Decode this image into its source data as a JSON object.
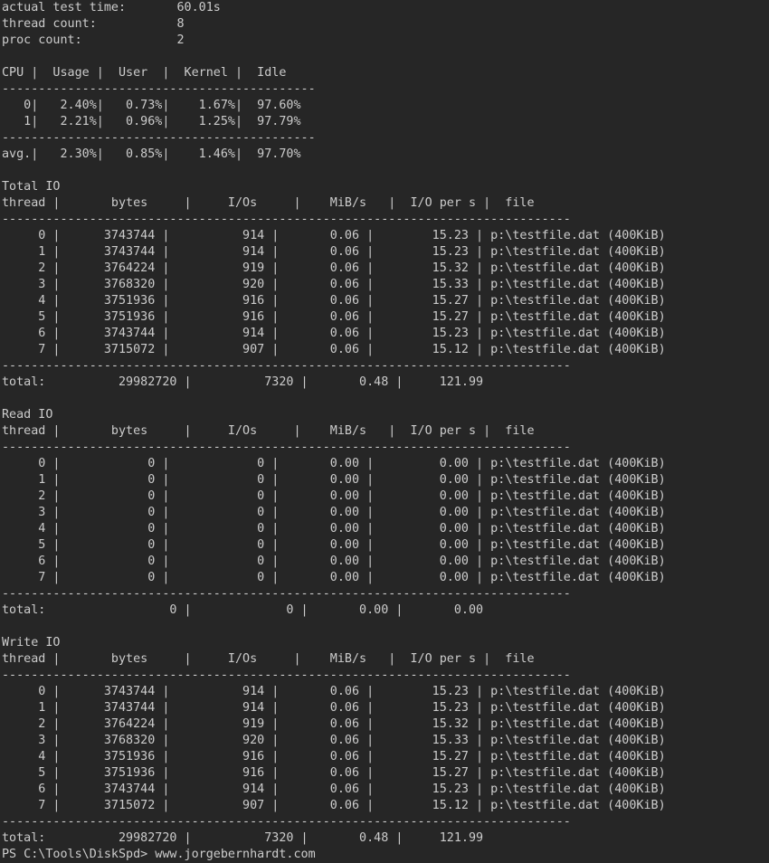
{
  "colors": {
    "background": "#262626",
    "foreground": "#cccccc"
  },
  "summary": [
    {
      "label": "actual test time:",
      "value": "60.01s"
    },
    {
      "label": "thread count:",
      "value": "8"
    },
    {
      "label": "proc count:",
      "value": "2"
    }
  ],
  "cpu_table": {
    "header": "CPU |  Usage |  User  |  Kernel |  Idle",
    "columns": [
      "CPU",
      "Usage",
      "User",
      "Kernel",
      "Idle"
    ],
    "rows": [
      {
        "cpu": "0",
        "usage": "2.40%",
        "user": "0.73%",
        "kernel": "1.67%",
        "idle": "97.60%"
      },
      {
        "cpu": "1",
        "usage": "2.21%",
        "user": "0.96%",
        "kernel": "1.25%",
        "idle": "97.79%"
      }
    ],
    "avg": {
      "cpu": "avg.",
      "usage": "2.30%",
      "user": "0.85%",
      "kernel": "1.46%",
      "idle": "97.70%"
    }
  },
  "io_header": "thread |       bytes     |     I/Os     |    MiB/s   |  I/O per s |  file",
  "io_columns": [
    "thread",
    "bytes",
    "I/Os",
    "MiB/s",
    "I/O per s",
    "file"
  ],
  "io_sections": [
    {
      "title": "Total IO",
      "rows": [
        {
          "thread": "0",
          "bytes": "3743744",
          "ios": "914",
          "mib_s": "0.06",
          "io_per_s": "15.23",
          "file": "p:\\testfile.dat (400KiB)"
        },
        {
          "thread": "1",
          "bytes": "3743744",
          "ios": "914",
          "mib_s": "0.06",
          "io_per_s": "15.23",
          "file": "p:\\testfile.dat (400KiB)"
        },
        {
          "thread": "2",
          "bytes": "3764224",
          "ios": "919",
          "mib_s": "0.06",
          "io_per_s": "15.32",
          "file": "p:\\testfile.dat (400KiB)"
        },
        {
          "thread": "3",
          "bytes": "3768320",
          "ios": "920",
          "mib_s": "0.06",
          "io_per_s": "15.33",
          "file": "p:\\testfile.dat (400KiB)"
        },
        {
          "thread": "4",
          "bytes": "3751936",
          "ios": "916",
          "mib_s": "0.06",
          "io_per_s": "15.27",
          "file": "p:\\testfile.dat (400KiB)"
        },
        {
          "thread": "5",
          "bytes": "3751936",
          "ios": "916",
          "mib_s": "0.06",
          "io_per_s": "15.27",
          "file": "p:\\testfile.dat (400KiB)"
        },
        {
          "thread": "6",
          "bytes": "3743744",
          "ios": "914",
          "mib_s": "0.06",
          "io_per_s": "15.23",
          "file": "p:\\testfile.dat (400KiB)"
        },
        {
          "thread": "7",
          "bytes": "3715072",
          "ios": "907",
          "mib_s": "0.06",
          "io_per_s": "15.12",
          "file": "p:\\testfile.dat (400KiB)"
        }
      ],
      "total": {
        "label": "total:",
        "bytes": "29982720",
        "ios": "7320",
        "mib_s": "0.48",
        "io_per_s": "121.99"
      }
    },
    {
      "title": "Read IO",
      "rows": [
        {
          "thread": "0",
          "bytes": "0",
          "ios": "0",
          "mib_s": "0.00",
          "io_per_s": "0.00",
          "file": "p:\\testfile.dat (400KiB)"
        },
        {
          "thread": "1",
          "bytes": "0",
          "ios": "0",
          "mib_s": "0.00",
          "io_per_s": "0.00",
          "file": "p:\\testfile.dat (400KiB)"
        },
        {
          "thread": "2",
          "bytes": "0",
          "ios": "0",
          "mib_s": "0.00",
          "io_per_s": "0.00",
          "file": "p:\\testfile.dat (400KiB)"
        },
        {
          "thread": "3",
          "bytes": "0",
          "ios": "0",
          "mib_s": "0.00",
          "io_per_s": "0.00",
          "file": "p:\\testfile.dat (400KiB)"
        },
        {
          "thread": "4",
          "bytes": "0",
          "ios": "0",
          "mib_s": "0.00",
          "io_per_s": "0.00",
          "file": "p:\\testfile.dat (400KiB)"
        },
        {
          "thread": "5",
          "bytes": "0",
          "ios": "0",
          "mib_s": "0.00",
          "io_per_s": "0.00",
          "file": "p:\\testfile.dat (400KiB)"
        },
        {
          "thread": "6",
          "bytes": "0",
          "ios": "0",
          "mib_s": "0.00",
          "io_per_s": "0.00",
          "file": "p:\\testfile.dat (400KiB)"
        },
        {
          "thread": "7",
          "bytes": "0",
          "ios": "0",
          "mib_s": "0.00",
          "io_per_s": "0.00",
          "file": "p:\\testfile.dat (400KiB)"
        }
      ],
      "total": {
        "label": "total:",
        "bytes": "0",
        "ios": "0",
        "mib_s": "0.00",
        "io_per_s": "0.00"
      }
    },
    {
      "title": "Write IO",
      "rows": [
        {
          "thread": "0",
          "bytes": "3743744",
          "ios": "914",
          "mib_s": "0.06",
          "io_per_s": "15.23",
          "file": "p:\\testfile.dat (400KiB)"
        },
        {
          "thread": "1",
          "bytes": "3743744",
          "ios": "914",
          "mib_s": "0.06",
          "io_per_s": "15.23",
          "file": "p:\\testfile.dat (400KiB)"
        },
        {
          "thread": "2",
          "bytes": "3764224",
          "ios": "919",
          "mib_s": "0.06",
          "io_per_s": "15.32",
          "file": "p:\\testfile.dat (400KiB)"
        },
        {
          "thread": "3",
          "bytes": "3768320",
          "ios": "920",
          "mib_s": "0.06",
          "io_per_s": "15.33",
          "file": "p:\\testfile.dat (400KiB)"
        },
        {
          "thread": "4",
          "bytes": "3751936",
          "ios": "916",
          "mib_s": "0.06",
          "io_per_s": "15.27",
          "file": "p:\\testfile.dat (400KiB)"
        },
        {
          "thread": "5",
          "bytes": "3751936",
          "ios": "916",
          "mib_s": "0.06",
          "io_per_s": "15.27",
          "file": "p:\\testfile.dat (400KiB)"
        },
        {
          "thread": "6",
          "bytes": "3743744",
          "ios": "914",
          "mib_s": "0.06",
          "io_per_s": "15.23",
          "file": "p:\\testfile.dat (400KiB)"
        },
        {
          "thread": "7",
          "bytes": "3715072",
          "ios": "907",
          "mib_s": "0.06",
          "io_per_s": "15.12",
          "file": "p:\\testfile.dat (400KiB)"
        }
      ],
      "total": {
        "label": "total:",
        "bytes": "29982720",
        "ios": "7320",
        "mib_s": "0.48",
        "io_per_s": "121.99"
      }
    }
  ],
  "prompt_line": "PS C:\\Tools\\DiskSpd> www.jorgebernhardt.com",
  "prompt": {
    "path_prefix": "PS C:\\Tools\\DiskSpd>",
    "command": "www.jorgebernhardt.com"
  }
}
